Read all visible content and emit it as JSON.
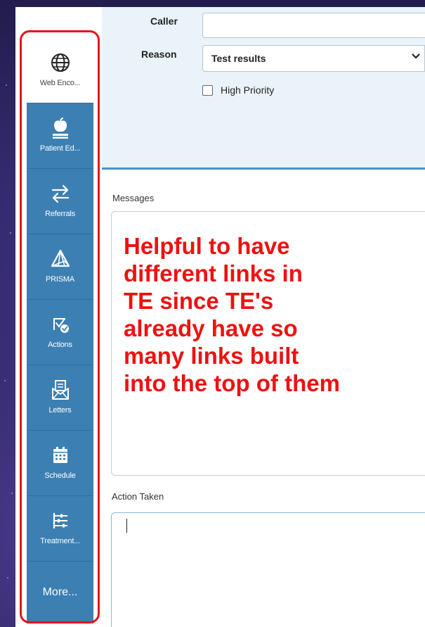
{
  "sidebar": {
    "items": [
      {
        "label": "Web Enco...",
        "icon": "globe-icon",
        "active": true
      },
      {
        "label": "Patient Ed...",
        "icon": "apple-book-icon",
        "active": false
      },
      {
        "label": "Referrals",
        "icon": "arrows-swap-icon",
        "active": false
      },
      {
        "label": "PRISMA",
        "icon": "pyramid-icon",
        "active": false
      },
      {
        "label": "Actions",
        "icon": "action-check-icon",
        "active": false
      },
      {
        "label": "Letters",
        "icon": "letter-icon",
        "active": false
      },
      {
        "label": "Schedule",
        "icon": "calendar-icon",
        "active": false
      },
      {
        "label": "Treatment...",
        "icon": "sliders-icon",
        "active": false
      }
    ],
    "more_label": "More...",
    "accent_color": "#3c7fb3",
    "outline_color": "#e8141b"
  },
  "form": {
    "caller_label": "Caller",
    "caller_value": "",
    "reason_label": "Reason",
    "reason_value": "Test results",
    "high_priority_label": "High Priority",
    "high_priority_checked": false
  },
  "messages": {
    "label": "Messages",
    "annotation": "Helpful to have\ndifferent links in\nTE since TE's\nalready have so\nmany links built\ninto the top of them",
    "annotation_color": "#ee1111"
  },
  "action_taken": {
    "label": "Action Taken",
    "value": ""
  }
}
